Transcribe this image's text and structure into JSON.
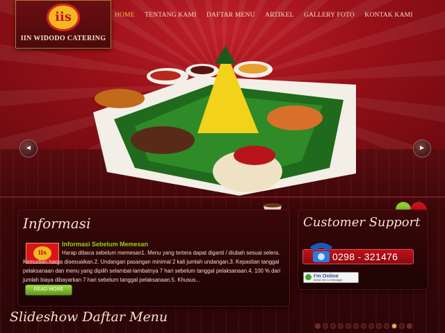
{
  "brand": {
    "logo_mark": "iis",
    "name": "IIN WIDODO CATERING"
  },
  "nav": {
    "items": [
      "HOME",
      "TENTANG KAMI",
      "DAFTAR MENU",
      "ARTIKEL",
      "GALLERY FOTO",
      "KONTAK KAMI"
    ],
    "active": "HOME"
  },
  "slider": {
    "prev_label": "◄",
    "next_label": "►"
  },
  "info": {
    "title": "Informasi",
    "thumb_mark": "iis",
    "post_title": "Informasi Sebelum Memesan",
    "post_body": "Harap dibaca sebelum memesan1. Menu yang tertera dapat diganti / diubah sesuai selera. Kemudian harga disesuaikan.2. Undangan pasangan minimal 2 kali jumlah undangan.3. Kepastian tanggal pelaksanaan dan menu yang dipilih selambat-lambatnya 7 hari sebelum tanggal pelaksanaan.4. 100 % dari jumlah biaya dibayarkan 7 hari sebelum tanggal pelaksanaan.5. Khusus...",
    "read_more": "READ MORE"
  },
  "support": {
    "title": "Customer Support",
    "phone": "0298 - 321476",
    "online_label": "I'm Online",
    "online_sub": "Send me a message"
  },
  "slideshow": {
    "title": "Slideshow Daftar Menu",
    "dot_count": 13,
    "active_dot": 10
  },
  "colors": {
    "accent_gold": "#f0c040",
    "green_head": "#8ed61e",
    "brand_red": "#c8101a"
  }
}
